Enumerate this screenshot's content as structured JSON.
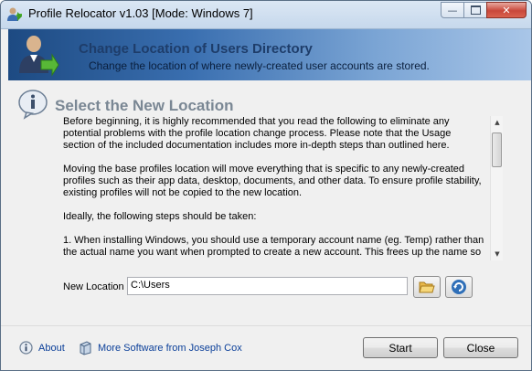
{
  "window": {
    "title": "Profile Relocator v1.03 [Mode: Windows 7]",
    "icon": "user-relocate-icon"
  },
  "banner": {
    "title": "Change Location of Users Directory",
    "subtitle": "Change the location of where newly-created user accounts are stored.",
    "icon": "user-arrow-icon"
  },
  "section": {
    "title": "Select the New Location",
    "icon": "info-icon"
  },
  "instructions": {
    "paragraphs": [
      "Before beginning, it is highly recommended that you read the following to eliminate any potential problems with the profile location change process. Please note that the Usage section of the included documentation includes more in-depth steps than outlined here.",
      "Moving the base profiles location will move everything that is specific to any newly-created profiles such as their app data, desktop, documents, and other data. To ensure profile stability, existing profiles will not be copied to the new location.",
      "Ideally, the following steps should be taken:",
      "1. When installing Windows, you should use a temporary account name (eg. Temp) rather than the actual name you want when prompted to create a new account. This frees up the name so"
    ]
  },
  "location": {
    "label": "New Location",
    "value": "C:\\Users",
    "browse_icon": "folder-open-icon",
    "refresh_icon": "refresh-icon"
  },
  "footer": {
    "about_label": "About",
    "more_software_label": "More Software from Joseph Cox",
    "start_label": "Start",
    "close_label": "Close"
  }
}
